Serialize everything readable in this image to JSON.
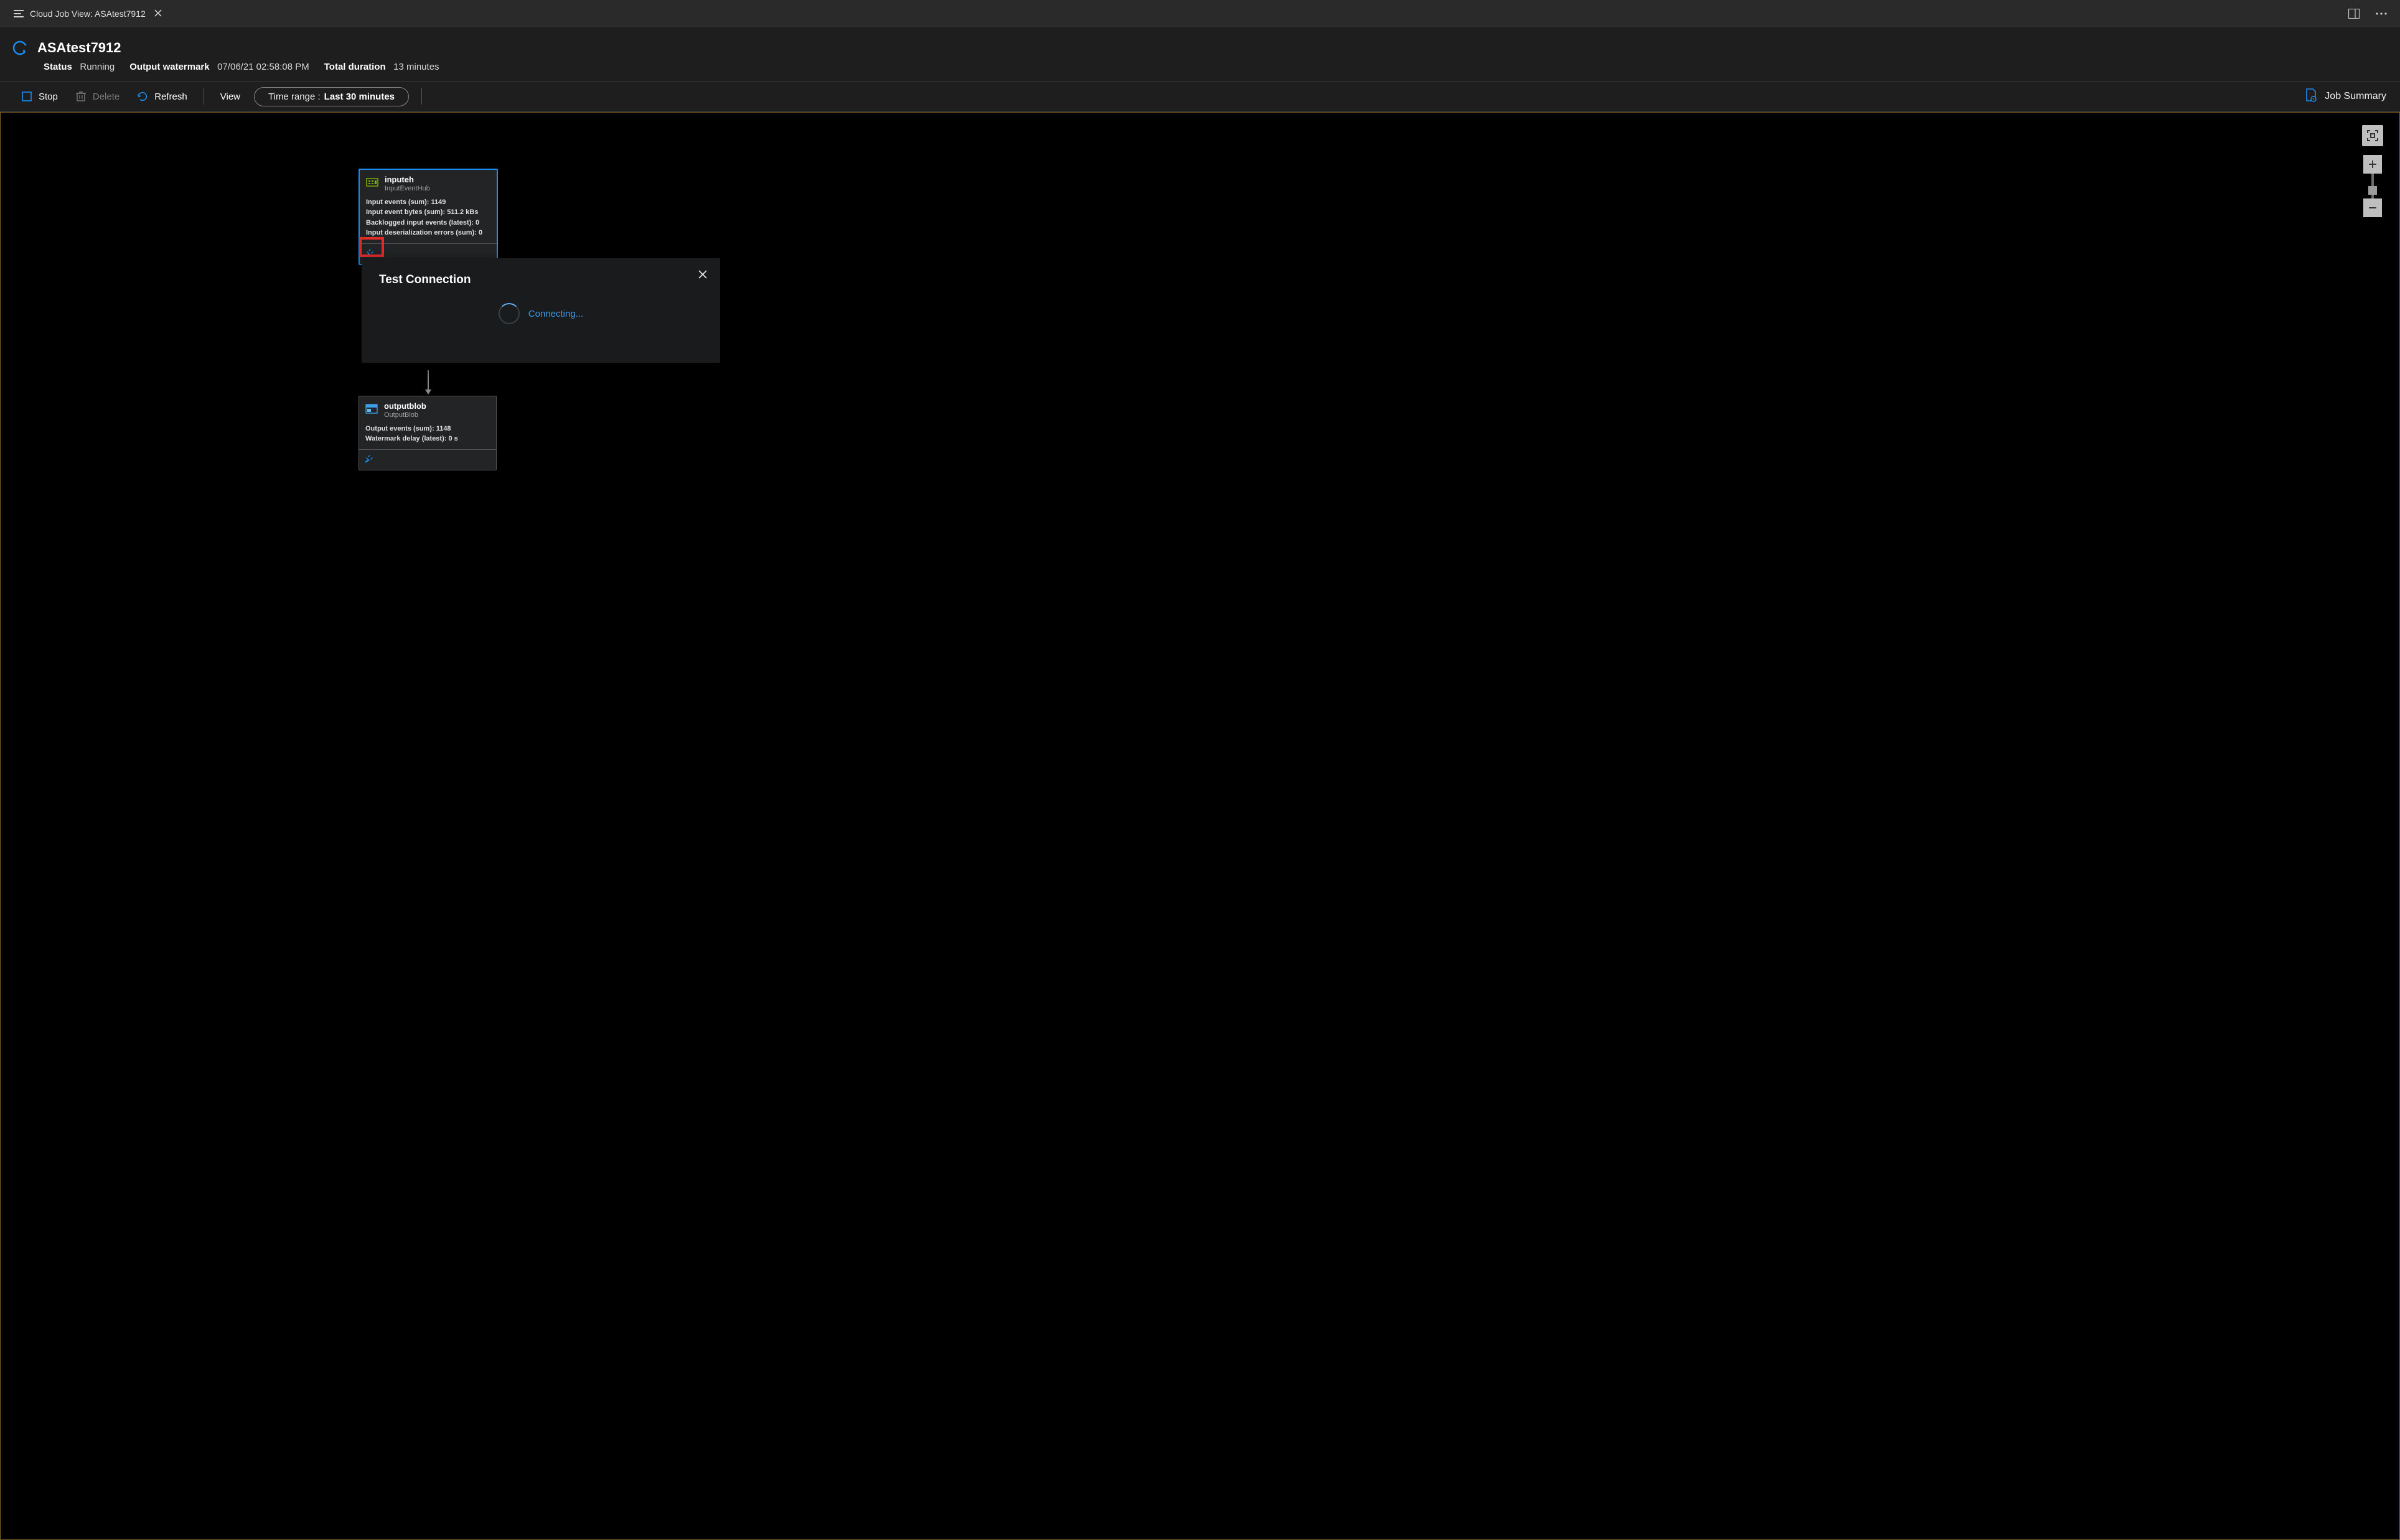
{
  "tab": {
    "title": "Cloud Job View: ASAtest7912"
  },
  "header": {
    "job_name": "ASAtest7912",
    "status_label": "Status",
    "status_value": "Running",
    "watermark_label": "Output watermark",
    "watermark_value": "07/06/21 02:58:08 PM",
    "duration_label": "Total duration",
    "duration_value": "13 minutes"
  },
  "toolbar": {
    "stop": "Stop",
    "delete": "Delete",
    "refresh": "Refresh",
    "view": "View",
    "time_range_label": "Time range :",
    "time_range_value": "Last 30 minutes",
    "job_summary": "Job Summary"
  },
  "nodes": {
    "input": {
      "title": "inputeh",
      "subtitle": "InputEventHub",
      "metrics": [
        {
          "label": "Input events (sum):",
          "value": "1149"
        },
        {
          "label": "Input event bytes (sum):",
          "value": "511.2 kBs"
        },
        {
          "label": "Backlogged input events (latest):",
          "value": "0"
        },
        {
          "label": "Input deserialization errors (sum):",
          "value": "0"
        }
      ]
    },
    "output": {
      "title": "outputblob",
      "subtitle": "OutputBlob",
      "metrics": [
        {
          "label": "Output events (sum):",
          "value": "1148"
        },
        {
          "label": "Watermark delay (latest):",
          "value": "0 s"
        }
      ]
    }
  },
  "popup": {
    "title": "Test Connection",
    "status": "Connecting..."
  },
  "colors": {
    "accent": "#1b8cf0",
    "highlight": "#e02b2b",
    "canvas_border": "#7a5e20"
  }
}
